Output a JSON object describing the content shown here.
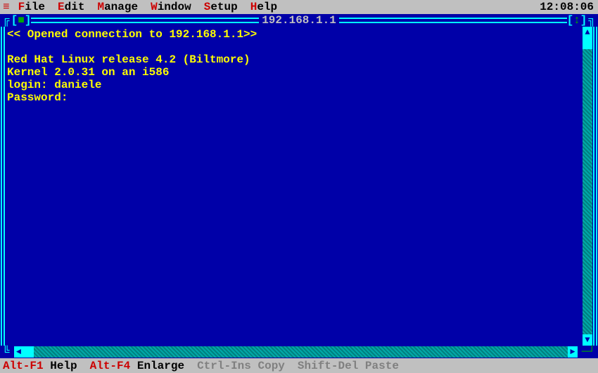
{
  "menubar": {
    "items": [
      {
        "hotkey": "F",
        "rest": "ile"
      },
      {
        "hotkey": "E",
        "rest": "dit"
      },
      {
        "hotkey": "M",
        "rest": "anage"
      },
      {
        "hotkey": "W",
        "rest": "indow"
      },
      {
        "hotkey": "S",
        "rest": "etup"
      },
      {
        "hotkey": "H",
        "rest": "elp"
      }
    ],
    "clock": "12:08:06"
  },
  "window": {
    "title": "192.168.1.1"
  },
  "terminal": {
    "lines": [
      "<< Opened connection to 192.168.1.1>>",
      "",
      "Red Hat Linux release 4.2 (Biltmore)",
      "Kernel 2.0.31 on an i586",
      "login: daniele",
      "Password:"
    ]
  },
  "statusbar": {
    "items": [
      {
        "key": "Alt-F1",
        "label": "Help",
        "disabled": false
      },
      {
        "key": "Alt-F4",
        "label": "Enlarge",
        "disabled": false
      },
      {
        "key": "Ctrl-Ins",
        "label": "Copy",
        "disabled": true
      },
      {
        "key": "Shift-Del",
        "label": "Paste",
        "disabled": true
      }
    ]
  }
}
